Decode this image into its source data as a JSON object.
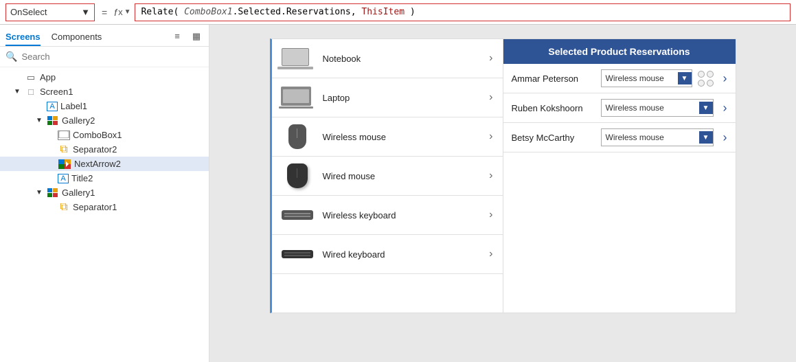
{
  "formula_bar": {
    "select_value": "OnSelect",
    "select_label": "OnSelect",
    "eq_symbol": "=",
    "fx_label": "fx",
    "formula": "Relate( ComboBox1.Selected.Reservations, ThisItem )"
  },
  "left_panel": {
    "tabs": [
      {
        "label": "Screens",
        "active": true
      },
      {
        "label": "Components",
        "active": false
      }
    ],
    "search_placeholder": "Search",
    "tree_items": [
      {
        "label": "App",
        "indent": 0,
        "icon": "app",
        "chevron": ""
      },
      {
        "label": "Screen1",
        "indent": 0,
        "icon": "screen",
        "chevron": "▼"
      },
      {
        "label": "Label1",
        "indent": 2,
        "icon": "label",
        "chevron": ""
      },
      {
        "label": "Gallery2",
        "indent": 2,
        "icon": "gallery",
        "chevron": "▼"
      },
      {
        "label": "ComboBox1",
        "indent": 3,
        "icon": "combobox",
        "chevron": ""
      },
      {
        "label": "Separator2",
        "indent": 3,
        "icon": "separator",
        "chevron": ""
      },
      {
        "label": "NextArrow2",
        "indent": 3,
        "icon": "nextarrow",
        "chevron": "",
        "selected": true
      },
      {
        "label": "Title2",
        "indent": 3,
        "icon": "title",
        "chevron": ""
      },
      {
        "label": "Gallery1",
        "indent": 2,
        "icon": "gallery",
        "chevron": "▼"
      },
      {
        "label": "Separator1",
        "indent": 3,
        "icon": "separator",
        "chevron": ""
      }
    ]
  },
  "product_list": {
    "items": [
      {
        "name": "Notebook",
        "img": "notebook"
      },
      {
        "name": "Laptop",
        "img": "laptop"
      },
      {
        "name": "Wireless mouse",
        "img": "wmouse"
      },
      {
        "name": "Wired mouse",
        "img": "wiredmouse"
      },
      {
        "name": "Wireless keyboard",
        "img": "wkeyboard"
      },
      {
        "name": "Wired keyboard",
        "img": "wiredkeyboard"
      }
    ]
  },
  "reservations": {
    "title": "Selected Product Reservations",
    "rows": [
      {
        "name": "Ammar Peterson",
        "value": "Wireless mouse",
        "has_circles": true
      },
      {
        "name": "Ruben Kokshoorn",
        "value": "Wireless mouse",
        "has_circles": false
      },
      {
        "name": "Betsy McCarthy",
        "value": "Wireless mouse",
        "has_circles": false
      }
    ]
  }
}
